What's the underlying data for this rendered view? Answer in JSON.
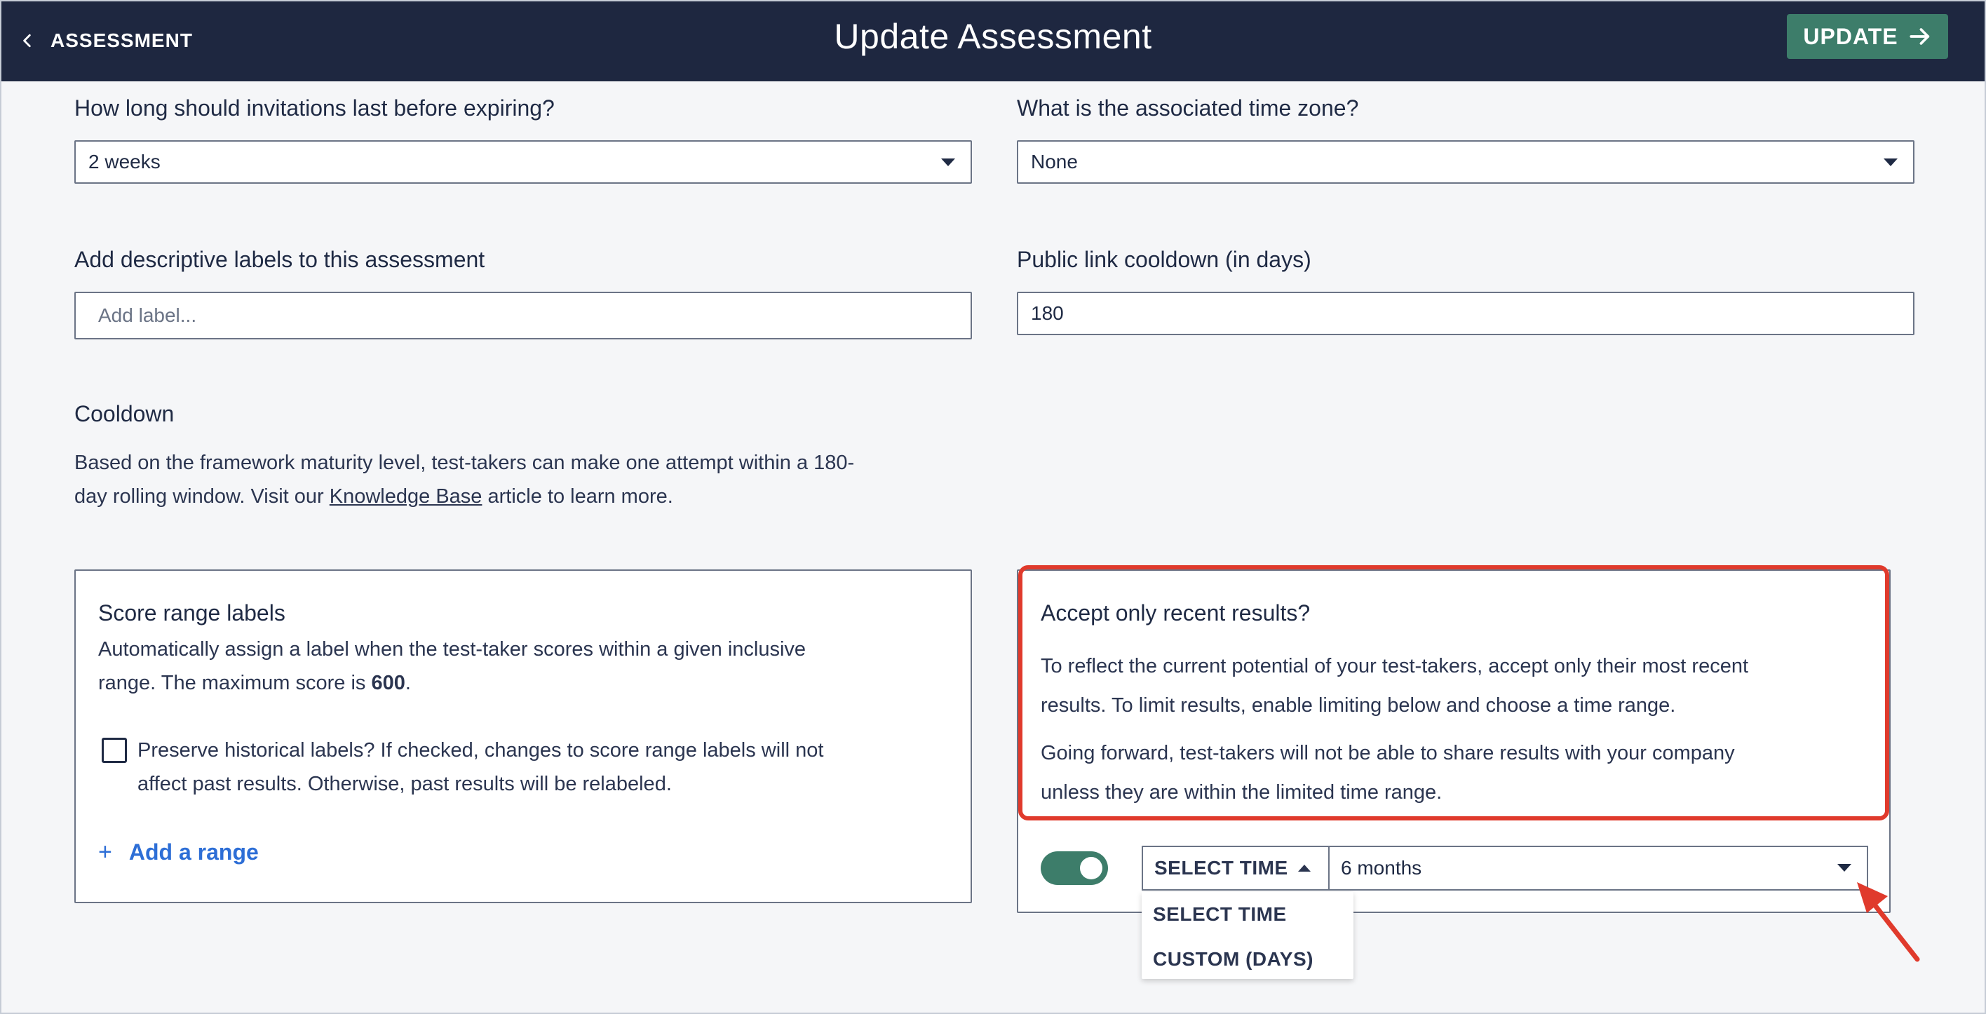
{
  "header": {
    "back_label": "ASSESSMENT",
    "title": "Update Assessment",
    "update_label": "UPDATE"
  },
  "invitations": {
    "label": "How long should invitations last before expiring?",
    "value": "2 weeks"
  },
  "timezone": {
    "label": "What is the associated time zone?",
    "value": "None"
  },
  "labels_field": {
    "label": "Add descriptive labels to this assessment",
    "placeholder": "Add label..."
  },
  "public_link": {
    "label": "Public link cooldown (in days)",
    "value": "180"
  },
  "cooldown": {
    "title": "Cooldown",
    "text_1": "Based on the framework maturity level, test-takers can make one attempt within a 180-",
    "text_2_before": "day rolling window. Visit our ",
    "link": "Knowledge Base",
    "text_2_after": " article to learn more."
  },
  "score_range": {
    "title": "Score range labels",
    "desc_1": "Automatically assign a label when the test-taker scores within a given inclusive",
    "desc_2_before": "range. The maximum score is ",
    "max_score": "600",
    "desc_2_after": ".",
    "preserve_1": "Preserve historical labels? If checked, changes to score range labels will not",
    "preserve_2": "affect past results. Otherwise, past results will be relabeled.",
    "add_range": "Add a range"
  },
  "recent_results": {
    "title": "Accept only recent results?",
    "para1_1": "To reflect the current potential of your test-takers, accept only their most recent",
    "para1_2": "results. To limit results, enable limiting below and choose a time range.",
    "para2_1": "Going forward, test-takers will not be able to share results with your company",
    "para2_2": "unless they are within the limited time range.",
    "toggle_on": true,
    "select_time_label": "SELECT TIME",
    "selected_value": "6 months",
    "options": [
      "SELECT TIME",
      "CUSTOM (DAYS)"
    ]
  },
  "colors": {
    "header_bg": "#1e2740",
    "accent_green": "#3d7d6a",
    "link_blue": "#2d6ed6",
    "highlight_red": "#e03a2c"
  }
}
